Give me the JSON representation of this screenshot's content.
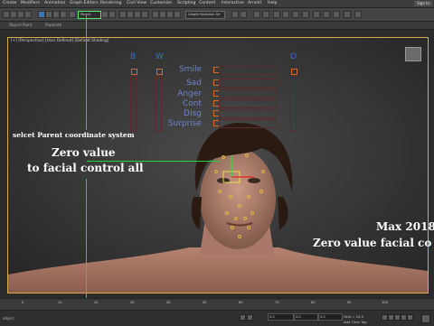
{
  "menubar": {
    "items": [
      "Create",
      "Modifiers",
      "Animation",
      "Graph Editors",
      "Rendering",
      "Civil View",
      "Customize",
      "Scripting",
      "Content",
      "Interactive",
      "Arnold",
      "Help"
    ],
    "sign_in": "Sign In"
  },
  "toolbar": {
    "coord_system": "Parent",
    "selection_set": "Create Selection Se"
  },
  "ribbon": {
    "object_paint": "Object Paint",
    "populate": "Populate"
  },
  "viewport": {
    "label": "[+] [Perspective] [User Defined] [Default Shading]"
  },
  "facial_ui": {
    "column_labels": [
      "B",
      "W",
      "O"
    ],
    "controls": [
      "Smile",
      "Sad",
      "Anger",
      "Cont",
      "Disg",
      "Surprise"
    ]
  },
  "annotations": {
    "select_parent": "selcet Parent coordinate system",
    "zero_value_line1": "Zero value",
    "zero_value_line2": "to facial control all",
    "max_line1": "Max 2018",
    "max_line2": "Zero value facial co"
  },
  "timeline": {
    "ticks": [
      "0",
      "10",
      "20",
      "30",
      "40",
      "50",
      "60",
      "70",
      "80",
      "90",
      "100"
    ]
  },
  "status": {
    "x_value": "0.0",
    "y_value": "0.0",
    "z_value": "0.0",
    "grid": "Grid = 10.0",
    "add_time_tag": "Add Time Tag",
    "left_text": "object"
  },
  "colors": {
    "viewport_border": "#d9a94a",
    "highlight_green": "#25d43a",
    "control_orange": "#d46b2a",
    "control_blue": "#3b6fd0"
  }
}
